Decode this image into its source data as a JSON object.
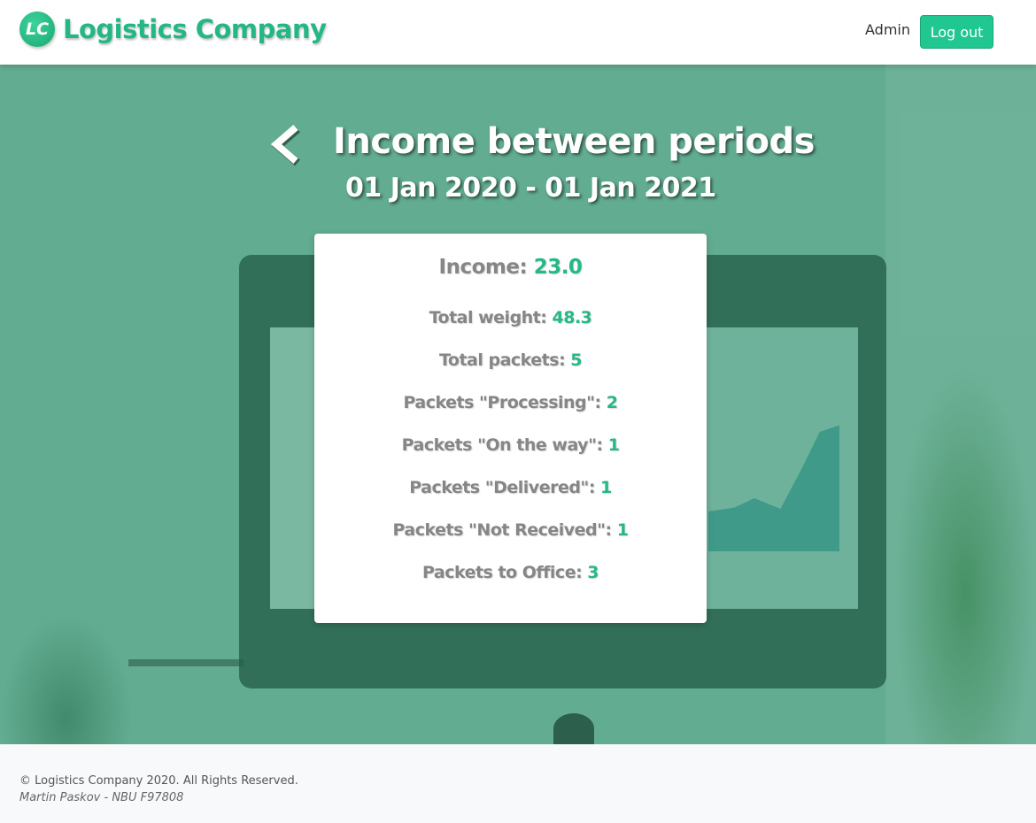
{
  "header": {
    "logo_text": "LC",
    "brand": "Logistics Company",
    "admin_label": "Admin",
    "logout_label": "Log out"
  },
  "hero": {
    "title": "Income between periods",
    "period": "01 Jan 2020 - 01 Jan 2021"
  },
  "stats": [
    {
      "label": "Income: ",
      "value": "23.0"
    },
    {
      "label": "Total weight: ",
      "value": "48.3"
    },
    {
      "label": "Total packets: ",
      "value": "5"
    },
    {
      "label": "Packets \"Processing\": ",
      "value": "2"
    },
    {
      "label": "Packets \"On the way\": ",
      "value": "1"
    },
    {
      "label": "Packets \"Delivered\": ",
      "value": "1"
    },
    {
      "label": "Packets \"Not Received\": ",
      "value": "1"
    },
    {
      "label": "Packets to Office: ",
      "value": "3"
    }
  ],
  "footer": {
    "copyright": "© Logistics Company 2020. All Rights Reserved.",
    "author": "Martin Paskov - NBU F97808"
  },
  "colors": {
    "accent": "#20c790",
    "value_text": "#26b886",
    "hero_overlay": "#62ac91"
  },
  "icons": {
    "back": "chevron-left-icon",
    "logo": "lc-logo-icon"
  }
}
